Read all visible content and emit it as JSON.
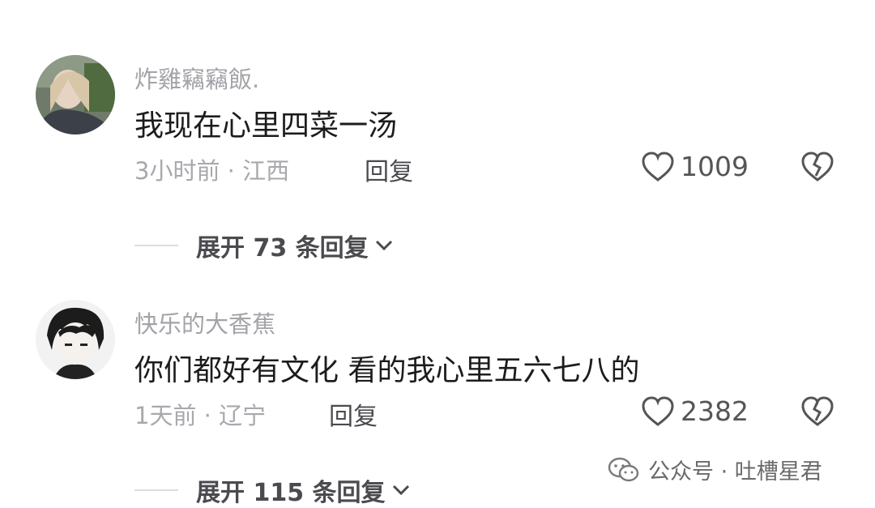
{
  "comments": [
    {
      "username": "炸雞竊竊飯.",
      "content": "我现在心里四菜一汤",
      "meta": "3小时前 · 江西",
      "reply_label": "回复",
      "likes": "1009",
      "expand_label": "展开 73 条回复"
    },
    {
      "username": "快乐的大香蕉",
      "content": "你们都好有文化 看的我心里五六七八的",
      "meta": "1天前 · 辽宁",
      "reply_label": "回复",
      "likes": "2382",
      "expand_label": "展开 115 条回复"
    }
  ],
  "watermark": {
    "text": "公众号 · 吐槽星君",
    "icon": "wechat-icon"
  },
  "icons": {
    "like": "heart-outline-icon",
    "dislike": "broken-heart-icon",
    "expand": "chevron-down-icon"
  }
}
